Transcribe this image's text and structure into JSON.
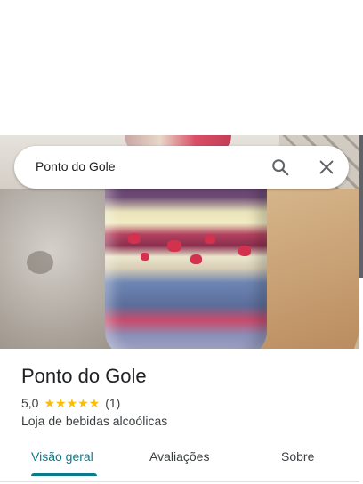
{
  "search": {
    "query": "Ponto do Gole"
  },
  "place": {
    "name": "Ponto do Gole",
    "rating": "5,0",
    "stars": "★★★★★",
    "review_count": "(1)",
    "category": "Loja de bebidas alcoólicas"
  },
  "tabs": [
    {
      "label": "Visão geral",
      "active": true
    },
    {
      "label": "Avaliações",
      "active": false
    },
    {
      "label": "Sobre",
      "active": false
    }
  ],
  "colors": {
    "accent": "#0b7a8a",
    "star": "#fbbc04",
    "text": "#202124"
  },
  "icons": {
    "search": "search-icon",
    "close": "close-icon"
  }
}
